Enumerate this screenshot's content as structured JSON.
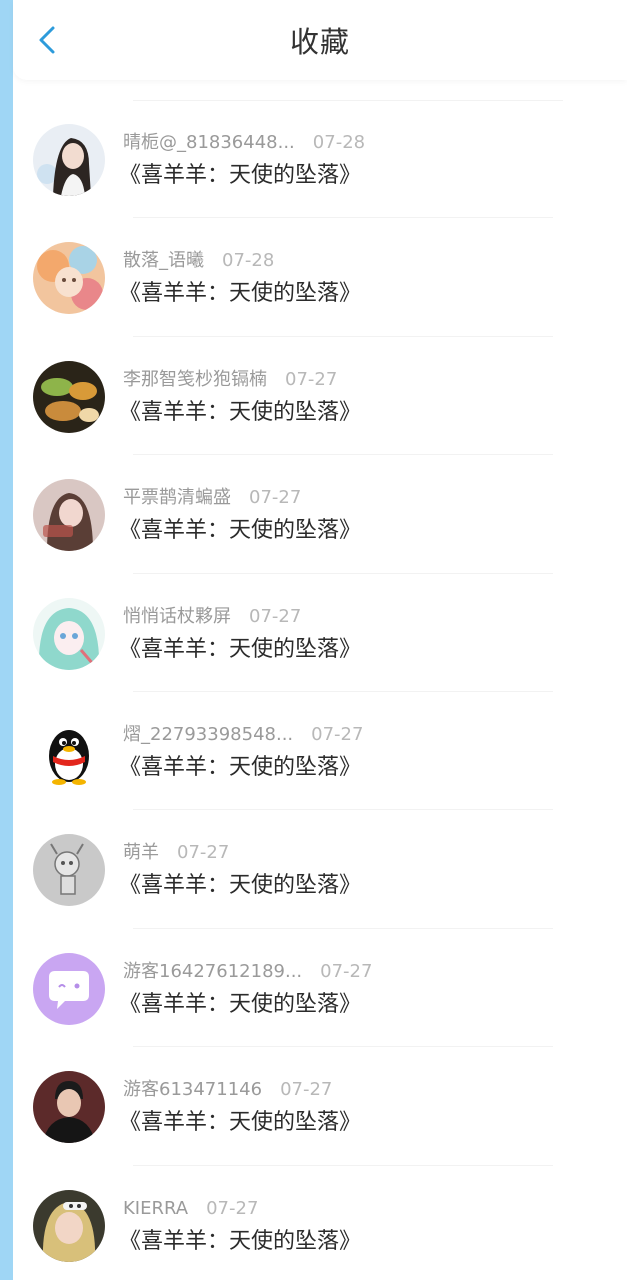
{
  "header": {
    "title": "收藏"
  },
  "items": [
    {
      "name": "晴栀@_81836448...",
      "date": "07-28",
      "text": "《喜羊羊：天使的坠落》"
    },
    {
      "name": "散落_语曦",
      "date": "07-28",
      "text": "《喜羊羊：天使的坠落》"
    },
    {
      "name": "李那智笺杪狍镉楠",
      "date": "07-27",
      "text": "《喜羊羊：天使的坠落》"
    },
    {
      "name": "平票鹊清蝙盛",
      "date": "07-27",
      "text": "《喜羊羊：天使的坠落》"
    },
    {
      "name": "悄悄话杖夥屏",
      "date": "07-27",
      "text": "《喜羊羊：天使的坠落》"
    },
    {
      "name": "熠_22793398548...",
      "date": "07-27",
      "text": "《喜羊羊：天使的坠落》"
    },
    {
      "name": "萌羊",
      "date": "07-27",
      "text": "《喜羊羊：天使的坠落》"
    },
    {
      "name": "游客16427612189...",
      "date": "07-27",
      "text": "《喜羊羊：天使的坠落》"
    },
    {
      "name": "游客613471146",
      "date": "07-27",
      "text": "《喜羊羊：天使的坠落》"
    },
    {
      "name": "KIERRA",
      "date": "07-27",
      "text": "《喜羊羊：天使的坠落》"
    }
  ],
  "colors": {
    "accent": "#2d9bdb",
    "side_strip": "#9fd6f5"
  }
}
